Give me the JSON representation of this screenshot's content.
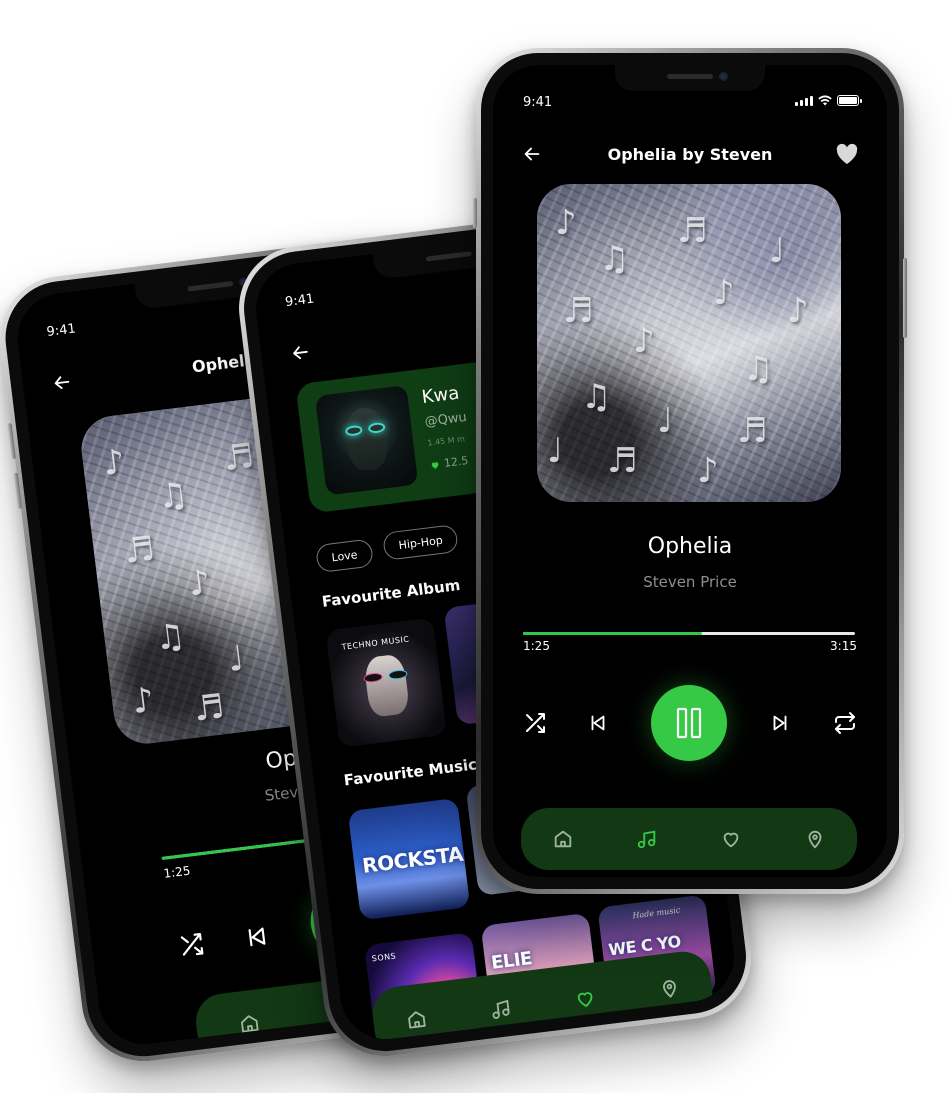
{
  "status": {
    "time": "9:41"
  },
  "player": {
    "screen_title": "Ophelia by Steven",
    "song_title": "Ophelia",
    "artist": "Steven Price",
    "elapsed": "1:25",
    "duration": "3:15",
    "progress": 0.54
  },
  "left_player": {
    "screen_title": "Ophelia by",
    "song_title": "Ophe",
    "artist": "Steven",
    "elapsed": "1:25"
  },
  "artist_card": {
    "name": "Kwa",
    "handle": "@Qwu",
    "meta": "1.45 M m",
    "likes": "12.5"
  },
  "genres": [
    "Love",
    "Hip-Hop"
  ],
  "sections": {
    "favourite_album": "Favourite Album",
    "favourite_music": "Favourite Music"
  },
  "albums": {
    "techno_label": "TECHNO MUSIC",
    "rockstar": "ROCKSTAR",
    "hade": "Hade music",
    "partial_text": "ELIE",
    "partial_text_2": "WE C YO",
    "sons": "SONS"
  },
  "nav": {
    "items": [
      "home-icon",
      "music-note-icon",
      "heart-icon",
      "location-pin-icon"
    ],
    "active_front": 1,
    "active_mid": 2,
    "active_color": "#36c946",
    "inactive_color": "#9fb5a0"
  },
  "colors": {
    "accent": "#36c946",
    "navbar": "#123814",
    "card": "#0f3d14",
    "background": "#000000"
  }
}
